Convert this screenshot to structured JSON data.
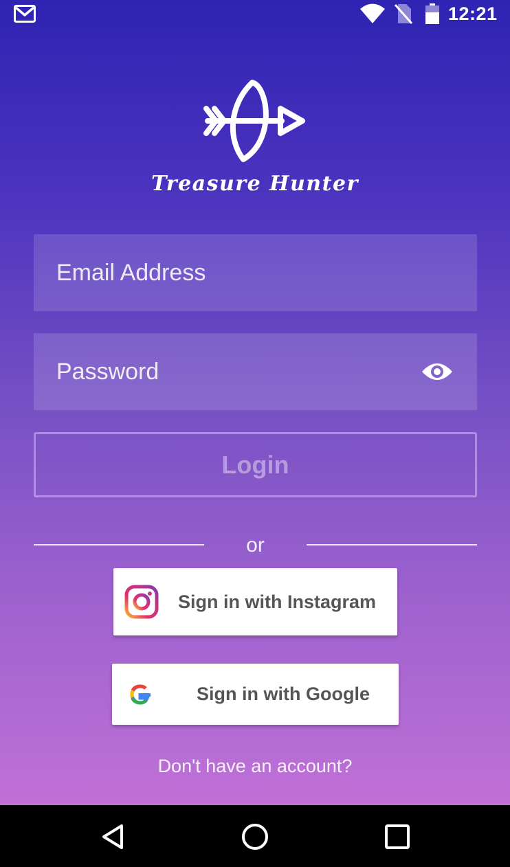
{
  "status_bar": {
    "time": "12:21",
    "icons": [
      "gmail-icon",
      "wifi-icon",
      "no-sim-icon",
      "battery-icon"
    ]
  },
  "app": {
    "name": "Treasure Hunter",
    "logo": "bow-arrow-logo"
  },
  "login_form": {
    "email_placeholder": "Email Address",
    "password_placeholder": "Password",
    "password_toggle_icon": "eye-icon",
    "login_label": "Login",
    "divider_text": "or",
    "instagram_label": "Sign in with Instagram",
    "google_label": "Sign in with Google",
    "signup_link": "Don't have an account?"
  },
  "nav_bar": {
    "icons": [
      "back-icon",
      "home-icon",
      "recents-icon"
    ]
  },
  "colors": {
    "gradient_top": "#2f23b3",
    "gradient_mid": "#7650c4",
    "gradient_bottom": "#c070d7",
    "button_bg": "#ffffff",
    "button_text": "#555555"
  }
}
